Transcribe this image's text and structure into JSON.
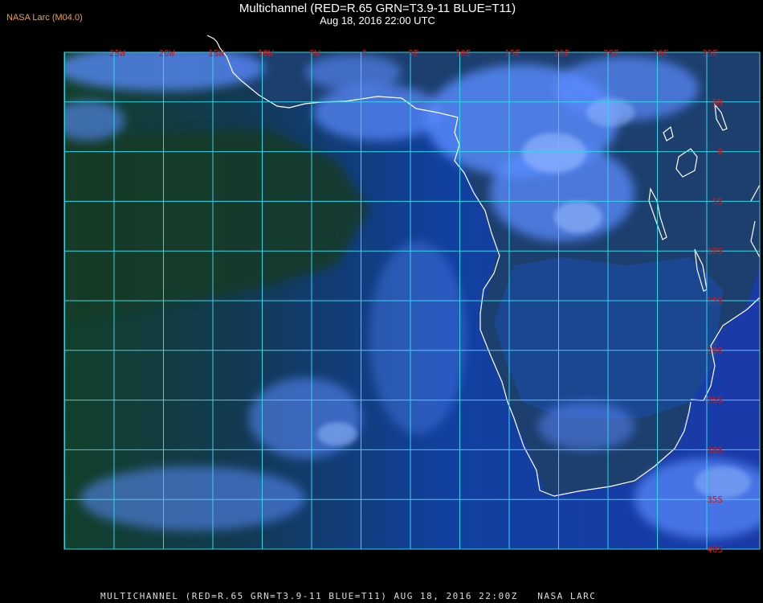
{
  "header": {
    "credit": "NASA Larc (M04.0)",
    "title": "Multichannel (RED=R.65 GRN=T3.9-11 BLUE=T11)",
    "subtitle": "Aug 18, 2016 22:00 UTC"
  },
  "footer": {
    "caption": "MULTICHANNEL (RED=R.65 GRN=T3.9-11 BLUE=T11) AUG 18, 2016 22:00Z   NASA LARC"
  },
  "map": {
    "longitude_labels": [
      "25W",
      "20W",
      "15W",
      "10W",
      "5W",
      "0",
      "5E",
      "10E",
      "15E",
      "20E",
      "25E",
      "30E",
      "35E"
    ],
    "latitude_labels": [
      "5N",
      "0",
      "5S",
      "10S",
      "15S",
      "20S",
      "25S",
      "30S",
      "35S",
      "40S"
    ],
    "colors": {
      "gridline": "#33d6e8",
      "label": "#cc1a1a",
      "coastline": "#ffffff",
      "ocean_clear": "#0f3a94",
      "land_dark": "#143a22",
      "cloud": "#5a8cff"
    }
  }
}
